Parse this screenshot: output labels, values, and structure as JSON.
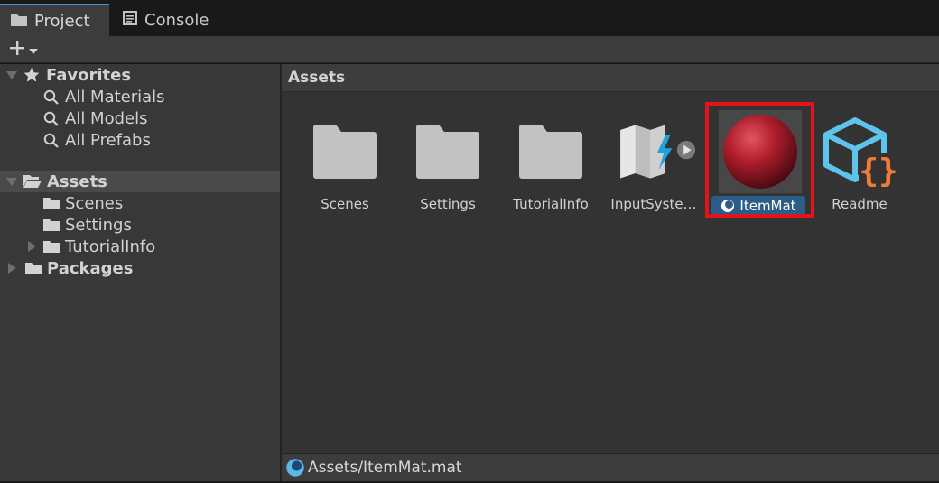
{
  "tabs": {
    "project_label": "Project",
    "console_label": "Console"
  },
  "toolbar": {
    "create_icon": "plus-icon",
    "dropdown_icon": "chevron-down-icon"
  },
  "tree": {
    "favorites": {
      "label": "Favorites",
      "items": [
        {
          "label": "All Materials",
          "icon": "search-icon"
        },
        {
          "label": "All Models",
          "icon": "search-icon"
        },
        {
          "label": "All Prefabs",
          "icon": "search-icon"
        }
      ]
    },
    "assets": {
      "label": "Assets",
      "children": [
        {
          "label": "Scenes"
        },
        {
          "label": "Settings"
        },
        {
          "label": "TutorialInfo"
        }
      ]
    },
    "packages": {
      "label": "Packages"
    }
  },
  "browser": {
    "header": "Assets",
    "items": [
      {
        "name": "Scenes",
        "icon": "folder-icon"
      },
      {
        "name": "Settings",
        "icon": "folder-icon"
      },
      {
        "name": "TutorialInfo",
        "icon": "folder-icon"
      },
      {
        "name": "InputSyste…",
        "icon": "input-actions-icon"
      },
      {
        "name": "ItemMat",
        "icon": "material-sphere-icon",
        "selected": true
      },
      {
        "name": "Readme",
        "icon": "readme-cube-icon"
      }
    ]
  },
  "status": {
    "path": "Assets/ItemMat.mat",
    "icon": "material-icon"
  },
  "colors": {
    "selection_blue": "#2c5d87",
    "highlight_red": "#e1141c",
    "material_red": "#b01e2c"
  }
}
